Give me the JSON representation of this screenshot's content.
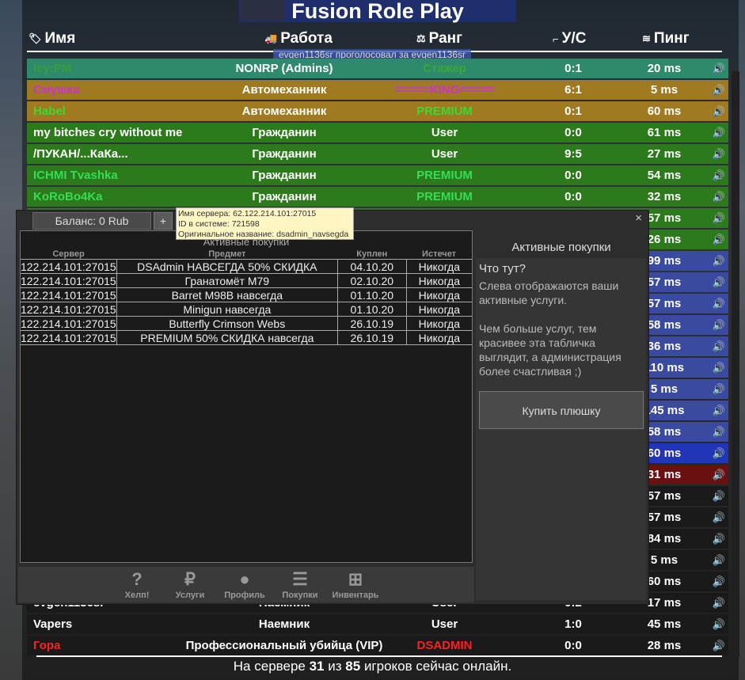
{
  "scoreboard": {
    "title": "Fusion Role Play",
    "headers": {
      "name": "Имя",
      "job": "Работа",
      "rank": "Ранг",
      "score": "У/С",
      "ping": "Пинг"
    },
    "vote_message": "evgen1136sr проголосовал за evgen1136sr",
    "rows": [
      {
        "name": "Icy:PM",
        "job": "NONRP (Admins)",
        "rank": "Стажер",
        "score": "0:1",
        "ping": "20 ms",
        "bg": "#2e8a6a",
        "name_color": "#3c9c3c",
        "rank_color": "#38a838"
      },
      {
        "name": "Смушка",
        "job": "Автомеханник",
        "rank": "=====KING=====",
        "score": "6:1",
        "ping": "5 ms",
        "bg": "#a07a20",
        "name_color": "#cc33cc",
        "rank_color": "#cc33cc"
      },
      {
        "name": "Habel",
        "job": "Автомеханник",
        "rank": "PREMIUM",
        "score": "0:1",
        "ping": "60 ms",
        "bg": "#a07a20",
        "name_color": "#33dd33",
        "rank_color": "#33dd33"
      },
      {
        "name": "my bitches cry without me",
        "job": "Гражданин",
        "rank": "User",
        "score": "0:0",
        "ping": "61 ms",
        "bg": "#2c7a1c",
        "name_color": "#ffffff",
        "rank_color": "#ffffff"
      },
      {
        "name": "/ПУКАН/...КаКа...",
        "job": "Гражданин",
        "rank": "User",
        "score": "9:5",
        "ping": "27 ms",
        "bg": "#2c7a1c",
        "name_color": "#ffffff",
        "rank_color": "#ffffff"
      },
      {
        "name": "ICHMI Tvashka",
        "job": "Гражданин",
        "rank": "PREMIUM",
        "score": "0:0",
        "ping": "54 ms",
        "bg": "#2c7a1c",
        "name_color": "#33dd55",
        "rank_color": "#33dd55"
      },
      {
        "name": "KoRoBo4Ka",
        "job": "Гражданин",
        "rank": "PREMIUM",
        "score": "0:0",
        "ping": "32 ms",
        "bg": "#2c7a1c",
        "name_color": "#33dd55",
        "rank_color": "#33dd55"
      },
      {
        "name": "",
        "job": "",
        "rank": "",
        "score": "",
        "ping": "57 ms",
        "bg": "#2c7a1c",
        "name_color": "#ffffff",
        "rank_color": "#ffffff"
      },
      {
        "name": "",
        "job": "",
        "rank": "",
        "score": "",
        "ping": "26 ms",
        "bg": "#2c7a1c",
        "name_color": "#ffffff",
        "rank_color": "#ffffff"
      },
      {
        "name": "",
        "job": "",
        "rank": "",
        "score": "",
        "ping": "99 ms",
        "bg": "#3a4aa0",
        "name_color": "#ffffff",
        "rank_color": "#ffffff"
      },
      {
        "name": "",
        "job": "",
        "rank": "",
        "score": "",
        "ping": "57 ms",
        "bg": "#3a4aa0",
        "name_color": "#ffffff",
        "rank_color": "#ffffff"
      },
      {
        "name": "",
        "job": "",
        "rank": "",
        "score": "",
        "ping": "57 ms",
        "bg": "#3a4aa0",
        "name_color": "#ffffff",
        "rank_color": "#ffffff"
      },
      {
        "name": "",
        "job": "",
        "rank": "",
        "score": "",
        "ping": "58 ms",
        "bg": "#3a4aa0",
        "name_color": "#ffffff",
        "rank_color": "#ffffff"
      },
      {
        "name": "",
        "job": "",
        "rank": "",
        "score": "",
        "ping": "36 ms",
        "bg": "#3a4aa0",
        "name_color": "#ffffff",
        "rank_color": "#ffffff"
      },
      {
        "name": "",
        "job": "",
        "rank": "",
        "score": "",
        "ping": "110 ms",
        "bg": "#3a4aa0",
        "name_color": "#ffffff",
        "rank_color": "#ffffff"
      },
      {
        "name": "",
        "job": "",
        "rank": "",
        "score": "",
        "ping": "5 ms",
        "bg": "#3a4aa0",
        "name_color": "#ffffff",
        "rank_color": "#ffffff"
      },
      {
        "name": "",
        "job": "",
        "rank": "",
        "score": "",
        "ping": "145 ms",
        "bg": "#3a4aa0",
        "name_color": "#ffffff",
        "rank_color": "#ffffff"
      },
      {
        "name": "",
        "job": "",
        "rank": "",
        "score": "",
        "ping": "58 ms",
        "bg": "#3a4aa0",
        "name_color": "#ffffff",
        "rank_color": "#ffffff"
      },
      {
        "name": "",
        "job": "",
        "rank": "",
        "score": "",
        "ping": "60 ms",
        "bg": "#2234b8",
        "name_color": "#ffffff",
        "rank_color": "#ffffff"
      },
      {
        "name": "",
        "job": "",
        "rank": "",
        "score": "",
        "ping": "31 ms",
        "bg": "#6a1010",
        "name_color": "#ffffff",
        "rank_color": "#ffffff"
      },
      {
        "name": "",
        "job": "",
        "rank": "",
        "score": "",
        "ping": "57 ms",
        "bg": "#1a1a1a",
        "name_color": "#ffffff",
        "rank_color": "#ffffff"
      },
      {
        "name": "",
        "job": "",
        "rank": "",
        "score": "",
        "ping": "57 ms",
        "bg": "#1a1a1a",
        "name_color": "#ffffff",
        "rank_color": "#ffffff"
      },
      {
        "name": "",
        "job": "",
        "rank": "",
        "score": "",
        "ping": "84 ms",
        "bg": "#1a1a1a",
        "name_color": "#ffffff",
        "rank_color": "#ffffff"
      },
      {
        "name": "",
        "job": "",
        "rank": "",
        "score": "",
        "ping": "5 ms",
        "bg": "#1a1a1a",
        "name_color": "#ffffff",
        "rank_color": "#ffffff"
      },
      {
        "name": "",
        "job": "",
        "rank": "",
        "score": "",
        "ping": "60 ms",
        "bg": "#1a1a1a",
        "name_color": "#ffffff",
        "rank_color": "#ffffff"
      },
      {
        "name": "evgen1136sr",
        "job": "Наемник",
        "rank": "User",
        "score": "0:2",
        "ping": "17 ms",
        "bg": "#1a1a1a",
        "name_color": "#ffffff",
        "rank_color": "#ffffff"
      },
      {
        "name": "Vapers",
        "job": "Наемник",
        "rank": "User",
        "score": "1:0",
        "ping": "45 ms",
        "bg": "#1a1a1a",
        "name_color": "#ffffff",
        "rank_color": "#ffffff"
      },
      {
        "name": "Гора",
        "job": "Профессиональный убийца (VIP)",
        "rank": "DSADMIN",
        "score": "0:0",
        "ping": "28 ms",
        "bg": "#1a1a1a",
        "name_color": "#ff2020",
        "rank_color": "#ff2020"
      }
    ],
    "footer": {
      "prefix": "На сервере",
      "online": "31",
      "mid": "из",
      "total": "85",
      "suffix": "игроков сейчас онлайн."
    }
  },
  "shop": {
    "balance_tab": "Баланс: 0 Rub",
    "plus_label": "+",
    "close_label": "×",
    "tooltip": {
      "line1": "Имя сервера: 62.122.214.101:27015",
      "line2": "ID в системе: 721598",
      "line3": "Оригинальное название: dsadmin_navsegda"
    },
    "list_title": "Активные покупки",
    "columns": {
      "server": "Сервер",
      "item": "Предмет",
      "bought": "Куплен",
      "expires": "Истечет"
    },
    "purchases": [
      {
        "server": "122.214.101:27015",
        "item": "DSAdmin НАВСЕГДА 50% СКИДКА",
        "bought": "04.10.20",
        "expires": "Никогда"
      },
      {
        "server": "122.214.101:27015",
        "item": "Гранатомёт M79",
        "bought": "02.10.20",
        "expires": "Никогда"
      },
      {
        "server": "122.214.101:27015",
        "item": "Barret M98B навсегда",
        "bought": "01.10.20",
        "expires": "Никогда"
      },
      {
        "server": "122.214.101:27015",
        "item": "Minigun навсегда",
        "bought": "01.10.20",
        "expires": "Никогда"
      },
      {
        "server": "122.214.101:27015",
        "item": "Butterfly Crimson Webs",
        "bought": "26.10.19",
        "expires": "Никогда"
      },
      {
        "server": "122.214.101:27015",
        "item": "PREMIUM 50% СКИДКА навсегда",
        "bought": "26.10.19",
        "expires": "Никогда"
      }
    ],
    "side_title": "Активные покупки",
    "side_question": "Что тут?",
    "side_text1": "Слева отображаются ваши активные услуги.",
    "side_text2": "Чем больше услуг, тем красивее эта табличка выглядит, а администрация более счастливая ;)",
    "buy_button": "Купить плюшку",
    "nav": [
      {
        "label": "Хелп!",
        "icon": "help-icon"
      },
      {
        "label": "Услуги",
        "icon": "ruble-icon"
      },
      {
        "label": "Профиль",
        "icon": "user-icon"
      },
      {
        "label": "Покупки",
        "icon": "list-icon"
      },
      {
        "label": "Инвентарь",
        "icon": "inventory-icon"
      }
    ]
  }
}
